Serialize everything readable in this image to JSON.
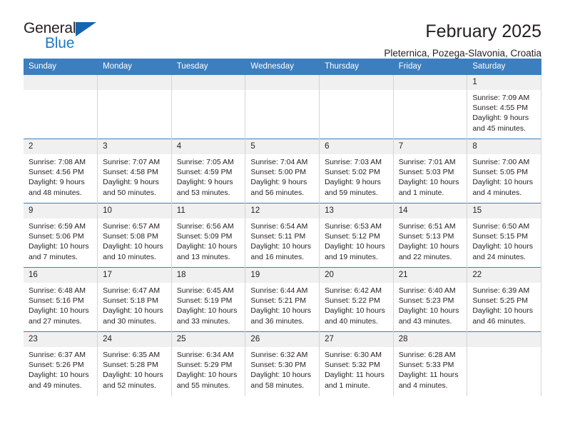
{
  "brand": {
    "name_top": "General",
    "name_bottom": "Blue",
    "triangle_color": "#1565b0",
    "blue_color": "#1f7ac4"
  },
  "header": {
    "title": "February 2025",
    "subtitle": "Pleternica, Pozega-Slavonia, Croatia"
  },
  "theme": {
    "header_blue": "#3d7ebf",
    "daynum_band": "#f0f0f0",
    "text": "#231f20"
  },
  "weekday_headers": [
    "Sunday",
    "Monday",
    "Tuesday",
    "Wednesday",
    "Thursday",
    "Friday",
    "Saturday"
  ],
  "weeks": [
    [
      {
        "day": "",
        "lines": []
      },
      {
        "day": "",
        "lines": []
      },
      {
        "day": "",
        "lines": []
      },
      {
        "day": "",
        "lines": []
      },
      {
        "day": "",
        "lines": []
      },
      {
        "day": "",
        "lines": []
      },
      {
        "day": "1",
        "lines": [
          "Sunrise: 7:09 AM",
          "Sunset: 4:55 PM",
          "Daylight: 9 hours",
          "and 45 minutes."
        ]
      }
    ],
    [
      {
        "day": "2",
        "lines": [
          "Sunrise: 7:08 AM",
          "Sunset: 4:56 PM",
          "Daylight: 9 hours",
          "and 48 minutes."
        ]
      },
      {
        "day": "3",
        "lines": [
          "Sunrise: 7:07 AM",
          "Sunset: 4:58 PM",
          "Daylight: 9 hours",
          "and 50 minutes."
        ]
      },
      {
        "day": "4",
        "lines": [
          "Sunrise: 7:05 AM",
          "Sunset: 4:59 PM",
          "Daylight: 9 hours",
          "and 53 minutes."
        ]
      },
      {
        "day": "5",
        "lines": [
          "Sunrise: 7:04 AM",
          "Sunset: 5:00 PM",
          "Daylight: 9 hours",
          "and 56 minutes."
        ]
      },
      {
        "day": "6",
        "lines": [
          "Sunrise: 7:03 AM",
          "Sunset: 5:02 PM",
          "Daylight: 9 hours",
          "and 59 minutes."
        ]
      },
      {
        "day": "7",
        "lines": [
          "Sunrise: 7:01 AM",
          "Sunset: 5:03 PM",
          "Daylight: 10 hours",
          "and 1 minute."
        ]
      },
      {
        "day": "8",
        "lines": [
          "Sunrise: 7:00 AM",
          "Sunset: 5:05 PM",
          "Daylight: 10 hours",
          "and 4 minutes."
        ]
      }
    ],
    [
      {
        "day": "9",
        "lines": [
          "Sunrise: 6:59 AM",
          "Sunset: 5:06 PM",
          "Daylight: 10 hours",
          "and 7 minutes."
        ]
      },
      {
        "day": "10",
        "lines": [
          "Sunrise: 6:57 AM",
          "Sunset: 5:08 PM",
          "Daylight: 10 hours",
          "and 10 minutes."
        ]
      },
      {
        "day": "11",
        "lines": [
          "Sunrise: 6:56 AM",
          "Sunset: 5:09 PM",
          "Daylight: 10 hours",
          "and 13 minutes."
        ]
      },
      {
        "day": "12",
        "lines": [
          "Sunrise: 6:54 AM",
          "Sunset: 5:11 PM",
          "Daylight: 10 hours",
          "and 16 minutes."
        ]
      },
      {
        "day": "13",
        "lines": [
          "Sunrise: 6:53 AM",
          "Sunset: 5:12 PM",
          "Daylight: 10 hours",
          "and 19 minutes."
        ]
      },
      {
        "day": "14",
        "lines": [
          "Sunrise: 6:51 AM",
          "Sunset: 5:13 PM",
          "Daylight: 10 hours",
          "and 22 minutes."
        ]
      },
      {
        "day": "15",
        "lines": [
          "Sunrise: 6:50 AM",
          "Sunset: 5:15 PM",
          "Daylight: 10 hours",
          "and 24 minutes."
        ]
      }
    ],
    [
      {
        "day": "16",
        "lines": [
          "Sunrise: 6:48 AM",
          "Sunset: 5:16 PM",
          "Daylight: 10 hours",
          "and 27 minutes."
        ]
      },
      {
        "day": "17",
        "lines": [
          "Sunrise: 6:47 AM",
          "Sunset: 5:18 PM",
          "Daylight: 10 hours",
          "and 30 minutes."
        ]
      },
      {
        "day": "18",
        "lines": [
          "Sunrise: 6:45 AM",
          "Sunset: 5:19 PM",
          "Daylight: 10 hours",
          "and 33 minutes."
        ]
      },
      {
        "day": "19",
        "lines": [
          "Sunrise: 6:44 AM",
          "Sunset: 5:21 PM",
          "Daylight: 10 hours",
          "and 36 minutes."
        ]
      },
      {
        "day": "20",
        "lines": [
          "Sunrise: 6:42 AM",
          "Sunset: 5:22 PM",
          "Daylight: 10 hours",
          "and 40 minutes."
        ]
      },
      {
        "day": "21",
        "lines": [
          "Sunrise: 6:40 AM",
          "Sunset: 5:23 PM",
          "Daylight: 10 hours",
          "and 43 minutes."
        ]
      },
      {
        "day": "22",
        "lines": [
          "Sunrise: 6:39 AM",
          "Sunset: 5:25 PM",
          "Daylight: 10 hours",
          "and 46 minutes."
        ]
      }
    ],
    [
      {
        "day": "23",
        "lines": [
          "Sunrise: 6:37 AM",
          "Sunset: 5:26 PM",
          "Daylight: 10 hours",
          "and 49 minutes."
        ]
      },
      {
        "day": "24",
        "lines": [
          "Sunrise: 6:35 AM",
          "Sunset: 5:28 PM",
          "Daylight: 10 hours",
          "and 52 minutes."
        ]
      },
      {
        "day": "25",
        "lines": [
          "Sunrise: 6:34 AM",
          "Sunset: 5:29 PM",
          "Daylight: 10 hours",
          "and 55 minutes."
        ]
      },
      {
        "day": "26",
        "lines": [
          "Sunrise: 6:32 AM",
          "Sunset: 5:30 PM",
          "Daylight: 10 hours",
          "and 58 minutes."
        ]
      },
      {
        "day": "27",
        "lines": [
          "Sunrise: 6:30 AM",
          "Sunset: 5:32 PM",
          "Daylight: 11 hours",
          "and 1 minute."
        ]
      },
      {
        "day": "28",
        "lines": [
          "Sunrise: 6:28 AM",
          "Sunset: 5:33 PM",
          "Daylight: 11 hours",
          "and 4 minutes."
        ]
      },
      {
        "day": "",
        "lines": []
      }
    ]
  ]
}
